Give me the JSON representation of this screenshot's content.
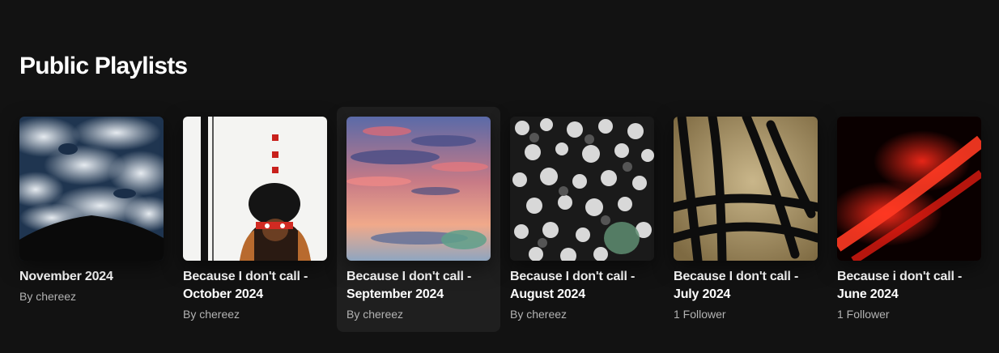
{
  "section": {
    "title": "Public Playlists"
  },
  "playlists": [
    {
      "title": "November 2024",
      "subtitle": "By chereez",
      "cover_icon": "cloudy-sky-image"
    },
    {
      "title": "Because I don't call - October 2024",
      "subtitle": "By chereez",
      "cover_icon": "woman-with-red-glasses-image"
    },
    {
      "title": "Because I don't call - September 2024",
      "subtitle": "By chereez",
      "cover_icon": "sunset-clouds-image"
    },
    {
      "title": "Because I don't call - August 2024",
      "subtitle": "By chereez",
      "cover_icon": "crowd-black-white-image"
    },
    {
      "title": "Because I don't call - July 2024",
      "subtitle": "1 Follower",
      "cover_icon": "graffiti-wall-image"
    },
    {
      "title": "Because i don't call - June 2024",
      "subtitle": "1 Follower",
      "cover_icon": "red-abstract-image"
    }
  ],
  "colors": {
    "background": "#121212",
    "card_hover": "#1f1f1f",
    "subtitle": "#b3b3b3"
  }
}
